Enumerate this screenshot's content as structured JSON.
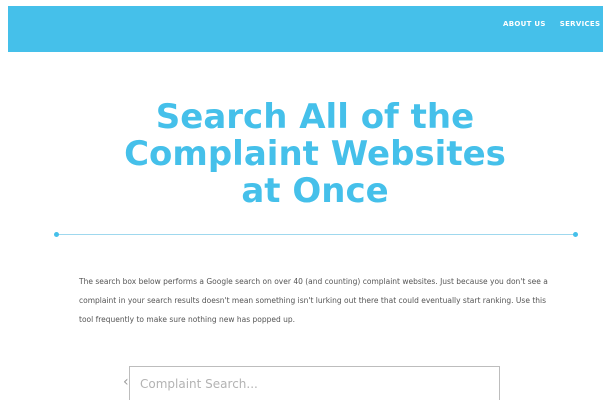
{
  "header": {
    "nav_items": [
      {
        "label": "ABOUT US"
      },
      {
        "label": "SERVICES"
      }
    ],
    "background_color": "#45c0ea"
  },
  "hero": {
    "title_lines": [
      "Search All of the",
      "Complaint Websites",
      "at Once"
    ],
    "title_color": "#45c0ea"
  },
  "description": "The search box below performs a Google search on over 40 (and counting) complaint websites. Just because you don't see a complaint in your search results doesn't mean something isn't lurking out there that could eventually start ranking. Use this tool frequently to make sure nothing new has popped up.",
  "search": {
    "placeholder": "Complaint Search...",
    "value": ""
  }
}
